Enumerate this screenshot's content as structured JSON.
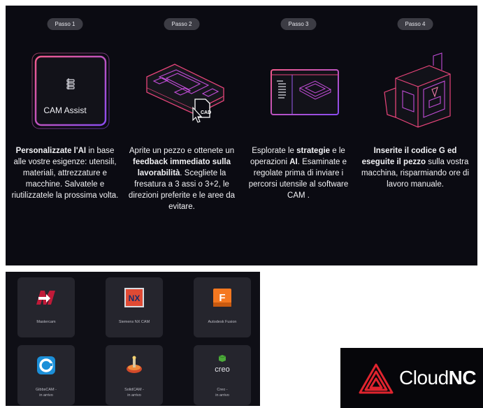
{
  "steps": [
    {
      "badge": "Passo 1",
      "cam_label": "CAM Assist",
      "bold1": "Personalizzate l'AI",
      "text1": " in base alle vostre esigenze: utensili, materiali, attrezzature e macchine. Salvatele e riutilizzatele la prossima volta."
    },
    {
      "badge": "Passo 2",
      "cad_label": "CAD",
      "text1": "Aprite un pezzo e ottenete un ",
      "bold1": "feedback immediato sulla lavorabilità",
      "text2": ". Scegliete la fresatura a 3 assi o 3+2, le direzioni preferite e le aree da evitare."
    },
    {
      "badge": "Passo 3",
      "text1": "Esplorate le ",
      "bold1": "strategie",
      "text2": " e le operazioni ",
      "bold2": "AI",
      "text3": ". Esaminate e regolate prima di inviare i percorsi utensile al software CAM ."
    },
    {
      "badge": "Passo 4",
      "bold1": "Inserite il codice G ed eseguite il pezzo",
      "text1": " sulla vostra macchina, risparmiando ore di lavoro manuale."
    }
  ],
  "cam_tiles": [
    {
      "name": "Mastercam",
      "icon": "mastercam-logo-icon"
    },
    {
      "name": "Siemens NX CAM",
      "icon": "nx-logo-icon",
      "logo_text": "NX"
    },
    {
      "name": "Autodesk Fusion",
      "icon": "fusion-logo-icon",
      "logo_text": "F"
    },
    {
      "name": "GibbsCAM - in arrivo",
      "line1": "GibbsCAM -",
      "line2": "in arrivo",
      "icon": "gibbscam-logo-icon"
    },
    {
      "name": "SolidCAM - in arrivo",
      "line1": "SolidCAM -",
      "line2": "in arrivo",
      "icon": "solidcam-logo-icon"
    },
    {
      "name": "Creo - in arrivo",
      "line1": "Creo -",
      "line2": "in arrivo",
      "icon": "creo-logo-icon",
      "logo_text": "creo"
    }
  ],
  "brand": {
    "part1": "Cloud",
    "part2": "NC"
  },
  "colors": {
    "accent_pink": "#e8447a",
    "accent_purple": "#9b5cf0",
    "brand_red": "#e0242e"
  }
}
